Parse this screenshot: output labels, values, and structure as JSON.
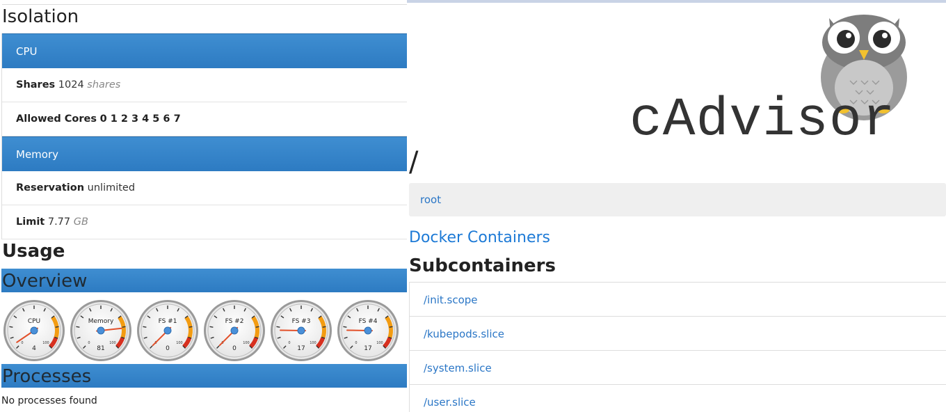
{
  "isolation": {
    "title": "Isolation",
    "cpu": {
      "header": "CPU",
      "shares_label": "Shares",
      "shares_value": "1024",
      "shares_unit": "shares",
      "cores_label": "Allowed Cores",
      "cores_value": "0 1 2 3 4 5 6 7"
    },
    "memory": {
      "header": "Memory",
      "reservation_label": "Reservation",
      "reservation_value": "unlimited",
      "limit_label": "Limit",
      "limit_value": "7.77",
      "limit_unit": "GB"
    }
  },
  "usage": {
    "title": "Usage",
    "overview_title": "Overview",
    "gauges": [
      {
        "label": "CPU",
        "value": 4
      },
      {
        "label": "Memory",
        "value": 81
      },
      {
        "label": "FS #1",
        "value": 0
      },
      {
        "label": "FS #2",
        "value": 0
      },
      {
        "label": "FS #3",
        "value": 17
      },
      {
        "label": "FS #4",
        "value": 17
      }
    ],
    "gauge_min_label": "0",
    "gauge_max_label": "100",
    "processes_title": "Processes",
    "processes_empty": "No processes found"
  },
  "logo": {
    "text": "cAdvisor"
  },
  "container": {
    "path_title": "/",
    "breadcrumb": "root",
    "docker_link": "Docker Containers",
    "subcontainers_title": "Subcontainers",
    "subcontainers": [
      "/init.scope",
      "/kubepods.slice",
      "/system.slice",
      "/user.slice"
    ]
  },
  "colors": {
    "panel_blue": "#3383c8",
    "link_blue": "#2a76c6",
    "gauge_orange": "#f39c12",
    "gauge_red": "#d7301f",
    "needle": "#e2512b"
  }
}
